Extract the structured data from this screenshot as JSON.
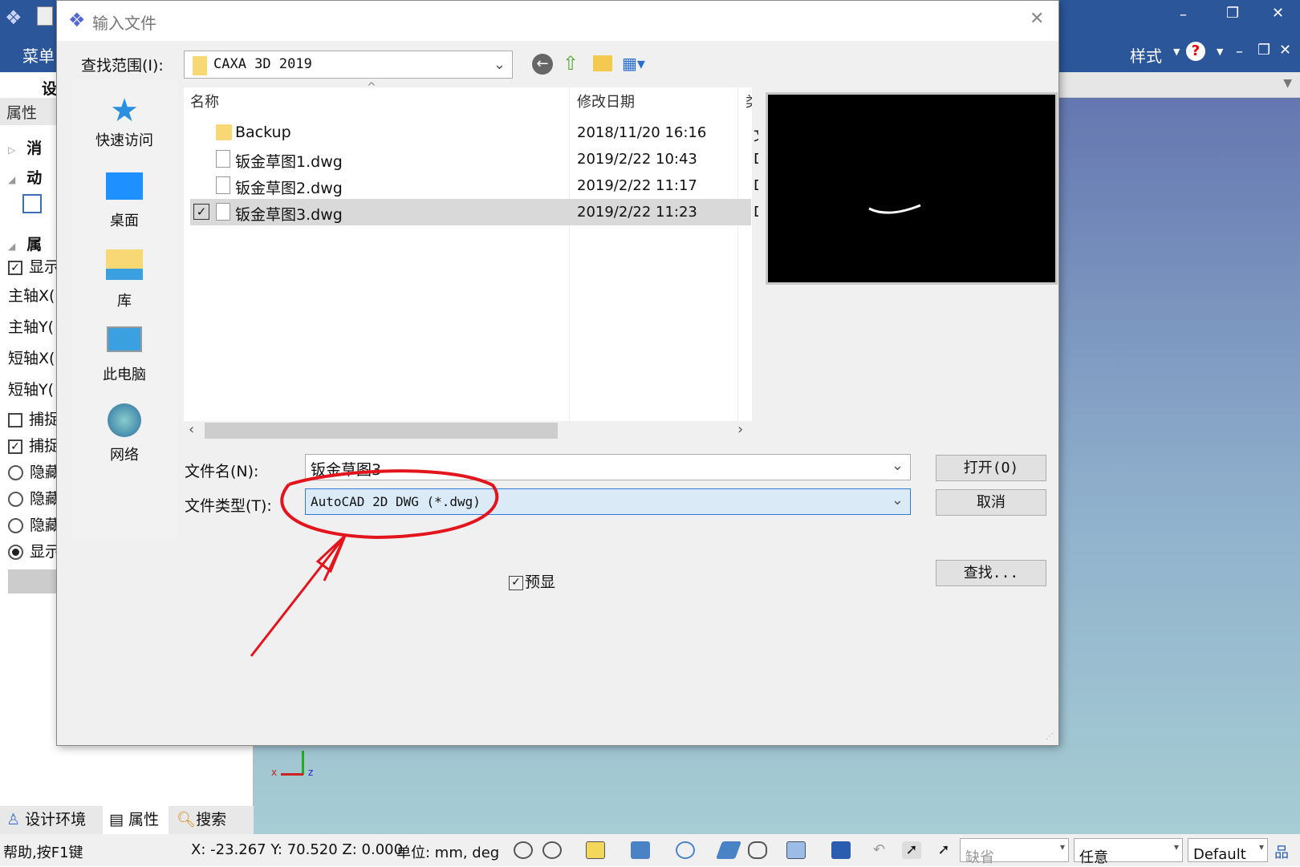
{
  "app": {
    "menu_label": "菜单",
    "style_label": "样式",
    "help_icon": "help-icon"
  },
  "left_panel": {
    "tab_partial": "设",
    "header": "属性",
    "items": [
      "消",
      "动",
      "属",
      "显示",
      "主轴X(",
      "主轴Y(",
      "短轴X(",
      "短轴Y(",
      "捕捉",
      "捕捉",
      "隐藏",
      "隐藏",
      "隐藏",
      "显示"
    ],
    "bottom_tabs": [
      "设计环境",
      "属性",
      "搜索"
    ]
  },
  "status": {
    "help": "帮助,按F1键",
    "coords": "X: -23.267 Y: 70.520 Z: 0.000",
    "units": "单位: mm, deg",
    "combo1": "缺省",
    "combo2": "任意",
    "combo3": "Default"
  },
  "dialog": {
    "title": "输入文件",
    "look_in_label": "查找范围(I):",
    "look_in_value": "CAXA 3D 2019",
    "places": [
      "快速访问",
      "桌面",
      "库",
      "此电脑",
      "网络"
    ],
    "columns": {
      "name": "名称",
      "date": "修改日期",
      "type": "类"
    },
    "files": [
      {
        "name": "Backup",
        "date": "2018/11/20 16:16",
        "type": "文",
        "kind": "folder",
        "selected": false
      },
      {
        "name": "钣金草图1.dwg",
        "date": "2019/2/22 10:43",
        "type": "D",
        "kind": "file",
        "selected": false
      },
      {
        "name": "钣金草图2.dwg",
        "date": "2019/2/22 11:17",
        "type": "D",
        "kind": "file",
        "selected": false
      },
      {
        "name": "钣金草图3.dwg",
        "date": "2019/2/22 11:23",
        "type": "D",
        "kind": "file",
        "selected": true
      }
    ],
    "filename_label": "文件名(N):",
    "filename_value": "钣金草图3",
    "filetype_label": "文件类型(T):",
    "filetype_value": "AutoCAD 2D DWG (*.dwg)",
    "open_button": "打开(O)",
    "cancel_button": "取消",
    "find_button": "查找...",
    "preview_label": "预显",
    "preview_checked": true
  },
  "annotation_color": "#e3141b"
}
